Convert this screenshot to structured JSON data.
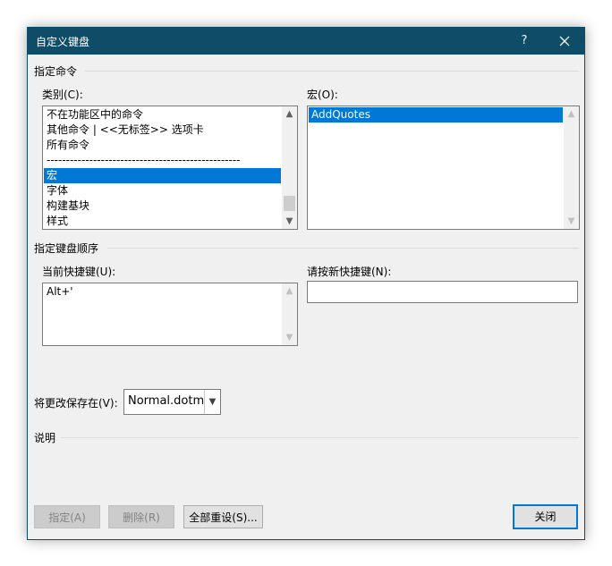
{
  "dialog": {
    "title": "自定义键盘",
    "help_label": "?"
  },
  "specify_command": {
    "section_label": "指定命令",
    "categories_label": "类别(C):",
    "categories": [
      "不在功能区中的命令",
      "其他命令 | <<无标签>> 选项卡",
      "所有命令",
      "--------------------------------------------------",
      "宏",
      "字体",
      "构建基块",
      "样式"
    ],
    "selected_category_index": 4,
    "macros_label": "宏(O):",
    "macros": [
      "AddQuotes"
    ],
    "selected_macro_index": 0
  },
  "keyboard_sequence": {
    "section_label": "指定键盘顺序",
    "current_keys_label": "当前快捷键(U):",
    "current_keys": [
      "Alt+'"
    ],
    "new_key_label": "请按新快捷键(N):",
    "new_key_value": ""
  },
  "save_in": {
    "label": "将更改保存在(V):",
    "value": "Normal.dotm"
  },
  "description": {
    "section_label": "说明"
  },
  "buttons": {
    "assign": "指定(A)",
    "remove": "删除(R)",
    "reset_all": "全部重设(S)...",
    "close": "关闭"
  },
  "colors": {
    "titlebar": "#0e4c67",
    "selection": "#0078d7"
  }
}
